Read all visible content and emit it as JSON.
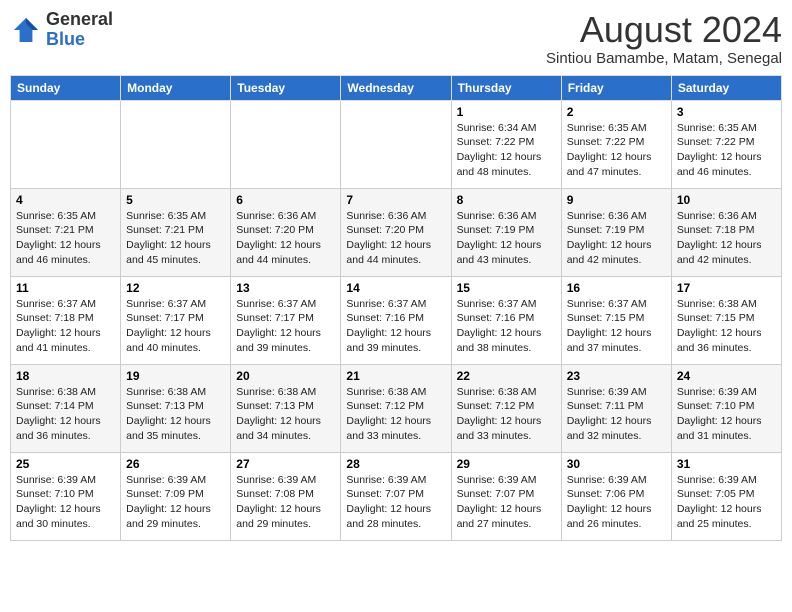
{
  "header": {
    "logo_line1": "General",
    "logo_line2": "Blue",
    "month_year": "August 2024",
    "location": "Sintiou Bamambe, Matam, Senegal"
  },
  "days_of_week": [
    "Sunday",
    "Monday",
    "Tuesday",
    "Wednesday",
    "Thursday",
    "Friday",
    "Saturday"
  ],
  "weeks": [
    [
      {
        "day": "",
        "info": ""
      },
      {
        "day": "",
        "info": ""
      },
      {
        "day": "",
        "info": ""
      },
      {
        "day": "",
        "info": ""
      },
      {
        "day": "1",
        "info": "Sunrise: 6:34 AM\nSunset: 7:22 PM\nDaylight: 12 hours\nand 48 minutes."
      },
      {
        "day": "2",
        "info": "Sunrise: 6:35 AM\nSunset: 7:22 PM\nDaylight: 12 hours\nand 47 minutes."
      },
      {
        "day": "3",
        "info": "Sunrise: 6:35 AM\nSunset: 7:22 PM\nDaylight: 12 hours\nand 46 minutes."
      }
    ],
    [
      {
        "day": "4",
        "info": "Sunrise: 6:35 AM\nSunset: 7:21 PM\nDaylight: 12 hours\nand 46 minutes."
      },
      {
        "day": "5",
        "info": "Sunrise: 6:35 AM\nSunset: 7:21 PM\nDaylight: 12 hours\nand 45 minutes."
      },
      {
        "day": "6",
        "info": "Sunrise: 6:36 AM\nSunset: 7:20 PM\nDaylight: 12 hours\nand 44 minutes."
      },
      {
        "day": "7",
        "info": "Sunrise: 6:36 AM\nSunset: 7:20 PM\nDaylight: 12 hours\nand 44 minutes."
      },
      {
        "day": "8",
        "info": "Sunrise: 6:36 AM\nSunset: 7:19 PM\nDaylight: 12 hours\nand 43 minutes."
      },
      {
        "day": "9",
        "info": "Sunrise: 6:36 AM\nSunset: 7:19 PM\nDaylight: 12 hours\nand 42 minutes."
      },
      {
        "day": "10",
        "info": "Sunrise: 6:36 AM\nSunset: 7:18 PM\nDaylight: 12 hours\nand 42 minutes."
      }
    ],
    [
      {
        "day": "11",
        "info": "Sunrise: 6:37 AM\nSunset: 7:18 PM\nDaylight: 12 hours\nand 41 minutes."
      },
      {
        "day": "12",
        "info": "Sunrise: 6:37 AM\nSunset: 7:17 PM\nDaylight: 12 hours\nand 40 minutes."
      },
      {
        "day": "13",
        "info": "Sunrise: 6:37 AM\nSunset: 7:17 PM\nDaylight: 12 hours\nand 39 minutes."
      },
      {
        "day": "14",
        "info": "Sunrise: 6:37 AM\nSunset: 7:16 PM\nDaylight: 12 hours\nand 39 minutes."
      },
      {
        "day": "15",
        "info": "Sunrise: 6:37 AM\nSunset: 7:16 PM\nDaylight: 12 hours\nand 38 minutes."
      },
      {
        "day": "16",
        "info": "Sunrise: 6:37 AM\nSunset: 7:15 PM\nDaylight: 12 hours\nand 37 minutes."
      },
      {
        "day": "17",
        "info": "Sunrise: 6:38 AM\nSunset: 7:15 PM\nDaylight: 12 hours\nand 36 minutes."
      }
    ],
    [
      {
        "day": "18",
        "info": "Sunrise: 6:38 AM\nSunset: 7:14 PM\nDaylight: 12 hours\nand 36 minutes."
      },
      {
        "day": "19",
        "info": "Sunrise: 6:38 AM\nSunset: 7:13 PM\nDaylight: 12 hours\nand 35 minutes."
      },
      {
        "day": "20",
        "info": "Sunrise: 6:38 AM\nSunset: 7:13 PM\nDaylight: 12 hours\nand 34 minutes."
      },
      {
        "day": "21",
        "info": "Sunrise: 6:38 AM\nSunset: 7:12 PM\nDaylight: 12 hours\nand 33 minutes."
      },
      {
        "day": "22",
        "info": "Sunrise: 6:38 AM\nSunset: 7:12 PM\nDaylight: 12 hours\nand 33 minutes."
      },
      {
        "day": "23",
        "info": "Sunrise: 6:39 AM\nSunset: 7:11 PM\nDaylight: 12 hours\nand 32 minutes."
      },
      {
        "day": "24",
        "info": "Sunrise: 6:39 AM\nSunset: 7:10 PM\nDaylight: 12 hours\nand 31 minutes."
      }
    ],
    [
      {
        "day": "25",
        "info": "Sunrise: 6:39 AM\nSunset: 7:10 PM\nDaylight: 12 hours\nand 30 minutes."
      },
      {
        "day": "26",
        "info": "Sunrise: 6:39 AM\nSunset: 7:09 PM\nDaylight: 12 hours\nand 29 minutes."
      },
      {
        "day": "27",
        "info": "Sunrise: 6:39 AM\nSunset: 7:08 PM\nDaylight: 12 hours\nand 29 minutes."
      },
      {
        "day": "28",
        "info": "Sunrise: 6:39 AM\nSunset: 7:07 PM\nDaylight: 12 hours\nand 28 minutes."
      },
      {
        "day": "29",
        "info": "Sunrise: 6:39 AM\nSunset: 7:07 PM\nDaylight: 12 hours\nand 27 minutes."
      },
      {
        "day": "30",
        "info": "Sunrise: 6:39 AM\nSunset: 7:06 PM\nDaylight: 12 hours\nand 26 minutes."
      },
      {
        "day": "31",
        "info": "Sunrise: 6:39 AM\nSunset: 7:05 PM\nDaylight: 12 hours\nand 25 minutes."
      }
    ]
  ]
}
